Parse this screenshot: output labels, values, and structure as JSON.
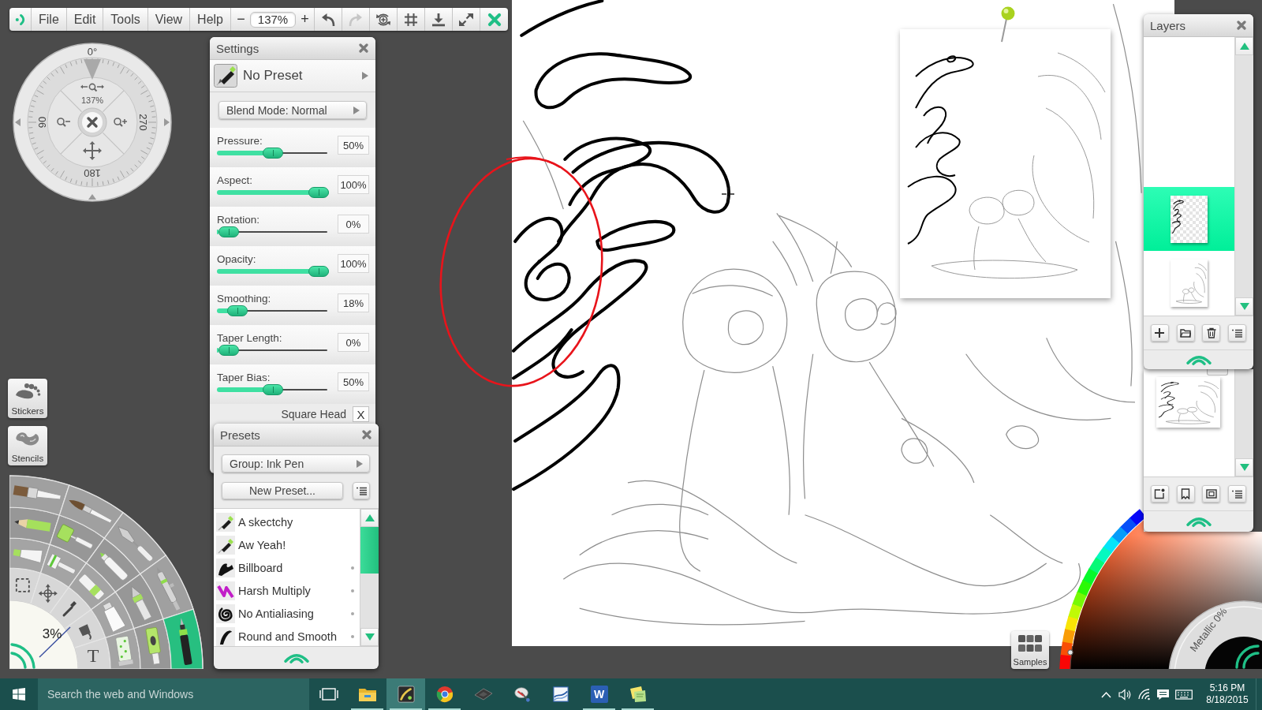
{
  "toolbar": {
    "menus": [
      {
        "label": "File"
      },
      {
        "label": "Edit"
      },
      {
        "label": "Tools"
      },
      {
        "label": "View"
      },
      {
        "label": "Help"
      }
    ],
    "zoom_out": "−",
    "zoom_value": "137%",
    "zoom_in": "+",
    "buttons": [
      {
        "kind": "undo",
        "disabled": false
      },
      {
        "kind": "redo",
        "disabled": true
      },
      {
        "kind": "rotate",
        "disabled": false
      },
      {
        "kind": "grid",
        "disabled": false
      },
      {
        "kind": "download",
        "disabled": false
      },
      {
        "kind": "fullscreen",
        "disabled": false
      },
      {
        "kind": "close",
        "disabled": false
      }
    ]
  },
  "navigator": {
    "angle": "0°",
    "zoom": "137%",
    "left_angle": "90",
    "right_angle": "270",
    "bottom_angle": "180"
  },
  "settings": {
    "title": "Settings",
    "preset": "No Preset",
    "blend_mode": "Blend Mode: Normal",
    "sliders": [
      {
        "label": "Pressure:",
        "value": "50%",
        "level": 0.5
      },
      {
        "label": "Aspect:",
        "value": "100%",
        "level": 1
      },
      {
        "label": "Rotation:",
        "value": "0%",
        "level": 0
      },
      {
        "label": "Opacity:",
        "value": "100%",
        "level": 1
      },
      {
        "label": "Smoothing:",
        "value": "18%",
        "level": 0.18
      },
      {
        "label": "Taper Length:",
        "value": "0%",
        "level": 0
      },
      {
        "label": "Taper Bias:",
        "value": "50%",
        "level": 0.5
      }
    ],
    "square_head": {
      "label": "Square Head",
      "checked": true,
      "glyph": "X"
    }
  },
  "presets": {
    "title": "Presets",
    "group": "Group: Ink Pen",
    "new_button": "New Preset...",
    "items": [
      {
        "label": "A skectchy",
        "kind": "pen",
        "marked": false,
        "selected": false
      },
      {
        "label": "Aw Yeah!",
        "kind": "pen",
        "marked": false,
        "selected": false
      },
      {
        "label": "Billboard",
        "kind": "blot",
        "marked": true,
        "selected": false
      },
      {
        "label": "Harsh Multiply",
        "kind": "streak",
        "marked": true,
        "selected": false
      },
      {
        "label": "No Antialiasing",
        "kind": "spiral",
        "marked": true,
        "selected": false
      },
      {
        "label": "Round and Smooth",
        "kind": "swoosh",
        "marked": true,
        "selected": false
      }
    ]
  },
  "side_buttons": [
    {
      "label": "Stickers",
      "kind": "footprint"
    },
    {
      "label": "Stencils",
      "kind": "stencil"
    }
  ],
  "tool_wheel": {
    "size": "3%",
    "tools": [
      {
        "kind": "selection",
        "selected": false
      },
      {
        "kind": "transform",
        "selected": false
      },
      {
        "kind": "eyedropper",
        "selected": false
      },
      {
        "kind": "bucket",
        "selected": false
      },
      {
        "kind": "text",
        "glyph": "T",
        "selected": false
      },
      {
        "kind": "paint-tube",
        "selected": false
      },
      {
        "kind": "scraper",
        "selected": false
      },
      {
        "kind": "chalk",
        "selected": false
      },
      {
        "kind": "tube",
        "selected": false
      },
      {
        "kind": "glitter",
        "selected": false
      },
      {
        "kind": "pencil",
        "selected": false
      },
      {
        "kind": "roller",
        "selected": false
      },
      {
        "kind": "felt-pen",
        "selected": false
      },
      {
        "kind": "nib",
        "selected": false
      },
      {
        "kind": "sticker-spray",
        "selected": false
      },
      {
        "kind": "flat-brush",
        "selected": false
      },
      {
        "kind": "round-brush",
        "selected": false
      },
      {
        "kind": "palette-knife",
        "selected": false
      },
      {
        "kind": "airbrush",
        "selected": false
      },
      {
        "kind": "ink-pen",
        "selected": true
      }
    ]
  },
  "layers": {
    "title": "Layers",
    "items": [
      {
        "kind": "ink",
        "selected": true
      },
      {
        "kind": "sketch",
        "selected": false
      }
    ]
  },
  "color_picker": {
    "metallic": "Metallic 0%"
  },
  "samples": {
    "label": "Samples"
  },
  "taskbar": {
    "search_placeholder": "Search the web and Windows",
    "apps": [
      {
        "kind": "task-view",
        "running": false,
        "selected": false
      },
      {
        "kind": "folder",
        "running": true,
        "selected": false
      },
      {
        "kind": "paint",
        "running": true,
        "selected": true
      },
      {
        "kind": "browser",
        "running": true,
        "selected": false
      },
      {
        "kind": "tablet",
        "running": false,
        "selected": false
      },
      {
        "kind": "dish",
        "running": false,
        "selected": false
      },
      {
        "kind": "chart",
        "running": false,
        "selected": false
      },
      {
        "kind": "letter",
        "glyph": "W",
        "running": true,
        "selected": false
      },
      {
        "kind": "notes",
        "running": true,
        "selected": false
      }
    ],
    "time": "5:16 PM",
    "date": "8/18/2015"
  }
}
